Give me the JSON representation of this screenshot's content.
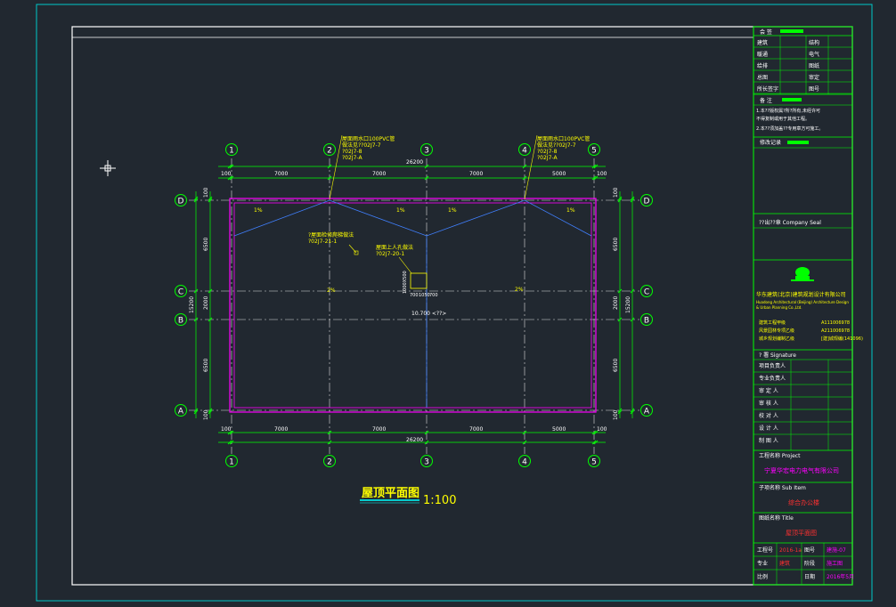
{
  "colors": {
    "background": "#212830",
    "frame": "#ffffff",
    "outer_frame": "#00c8c8",
    "grid_axis": "#00ff00",
    "roof_outline": "#ff00ff",
    "slope_lines": "#4080ff",
    "text_yellow": "#ffff00",
    "title_cyan": "#00ffff",
    "red_text": "#ff3030"
  },
  "drawing": {
    "title": "屋顶平面图",
    "scale": "1:100",
    "axes_horizontal": [
      "1",
      "2",
      "3",
      "4",
      "5"
    ],
    "axes_vertical": [
      "D",
      "C",
      "B",
      "A"
    ],
    "top_spans": [
      "7000",
      "7000",
      "7000",
      "5000"
    ],
    "top_total": "26200",
    "bottom_spans": [
      "7000",
      "7000",
      "7000",
      "5000"
    ],
    "bottom_total": "26200",
    "edge_offset": "100",
    "left_spans": [
      "6500",
      "2000",
      "6500"
    ],
    "left_total": "15200",
    "right_spans": [
      "6500",
      "2000",
      "6500"
    ],
    "right_total": "15200",
    "slope_labels": [
      "1%",
      "1%",
      "1%",
      "1%",
      "2%",
      "2%"
    ],
    "elevation": "10.700 <??>",
    "hatch_dims": [
      "700",
      "1050",
      "700"
    ],
    "hatch_size": "1000X500",
    "annotation_left_top": [
      "屋面雨水口100PVC管",
      "做法见??02J7-7",
      "?02J7-8",
      "?02J7-A"
    ],
    "annotation_right_top": [
      "屋面雨水口100PVC管",
      "做法见??02J7-7",
      "?02J7-8",
      "?02J7-A"
    ],
    "annotation_mid1": [
      "?屋面检修爬梯做法",
      "?02J7-21-1"
    ],
    "annotation_mid2": [
      "屋面上人孔做法",
      "?02J7-20-1"
    ]
  },
  "title_block": {
    "hui_qian": "会 签",
    "sign_rows": [
      [
        "建筑",
        "结构"
      ],
      [
        "暖通",
        "电气"
      ],
      [
        "给排",
        "图纸"
      ],
      [
        "总图",
        "审定"
      ],
      [
        "所长签字",
        "图号"
      ]
    ],
    "notes_header": "备 注",
    "notes": [
      "1.本??版权属?所?所有,未经许可",
      "  不得复制或用于其他工程。",
      "2.本??须加盖??专用章方可施工。"
    ],
    "revision_header": "修改记录",
    "stamp_header": "??出??章 Company Seal",
    "company_cn": "华东建筑(北京)建筑规划设计有限公司",
    "company_en_1": "Huadong Architectural (Beijing) Architecture Design",
    "company_en_2": "& Urban Planning Co.,Ltd.",
    "cert_rows": [
      [
        "建筑工程甲级",
        "A111006978"
      ],
      [
        "风景园林专项乙级",
        "A211006978"
      ],
      [
        "城乡规划编制乙级",
        "[建]城规编(141096)"
      ]
    ],
    "signature_header": "?  署 Signature",
    "signature_roles": [
      "项目负责人",
      "专业负责人",
      "审 定 人",
      "审 核 人",
      "校 对 人",
      "设 计 人",
      "制 图 人"
    ],
    "project_label": "工程名称 Project",
    "project_name": "宁夏华宏电力电气有限公司",
    "subitem_label": "子项名称 Sub Item",
    "subitem_name": "综合办公楼",
    "drawing_label": "图纸名称 Title",
    "drawing_name": "屋顶平面图",
    "bottom_rows": [
      [
        "工程号",
        "2016-1a",
        "图号",
        "建施-07"
      ],
      [
        "专业",
        "建筑",
        "阶段",
        "施工图"
      ],
      [
        "比例",
        "",
        "日期",
        "2016年5月"
      ]
    ]
  }
}
